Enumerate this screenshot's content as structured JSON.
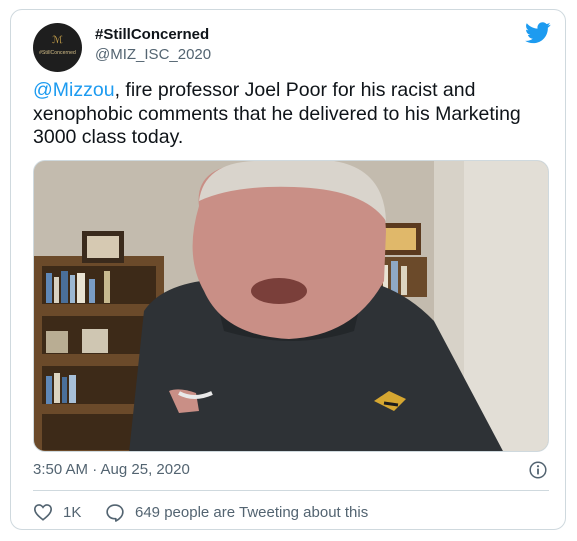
{
  "tweet": {
    "display_name": "#StillConcerned",
    "handle": "@MIZ_ISC_2020",
    "avatar_text": "#StillConcerned",
    "text_mention": "@Mizzou",
    "text_body": ", fire professor Joel Poor for his racist and xenophobic comments that he delivered to his Marketing 3000 class today.",
    "timestamp": "3:50 AM · Aug 25, 2020",
    "like_count": "1K",
    "retweet_text": "649 people are Tweeting about this"
  },
  "icons": {
    "brand": "twitter-bird-icon",
    "info": "info-icon",
    "like": "heart-icon",
    "reply": "speech-bubble-icon"
  },
  "colors": {
    "accent": "#1d9bf0",
    "text_primary": "#0f1419",
    "text_secondary": "#536471",
    "border": "#cfd9de"
  }
}
